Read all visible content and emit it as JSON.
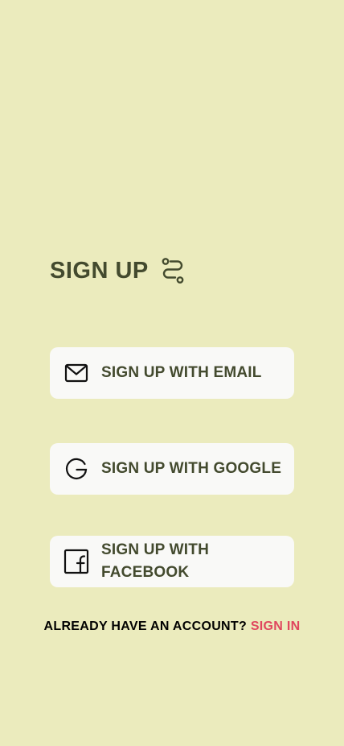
{
  "colors": {
    "background": "#ebebbd",
    "button_bg": "#f9f9f7",
    "text_dark": "#434a2e",
    "link": "#e0465e"
  },
  "header": {
    "title": "SIGN UP",
    "icon": "route-icon"
  },
  "buttons": [
    {
      "label": "SIGN UP WITH EMAIL",
      "icon": "mail-icon"
    },
    {
      "label": "SIGN UP WITH GOOGLE",
      "icon": "google-icon"
    },
    {
      "label": "SIGN UP WITH FACEBOOK",
      "icon": "facebook-icon"
    }
  ],
  "footer": {
    "prompt": "ALREADY HAVE AN ACCOUNT?",
    "link": "SIGN IN"
  }
}
